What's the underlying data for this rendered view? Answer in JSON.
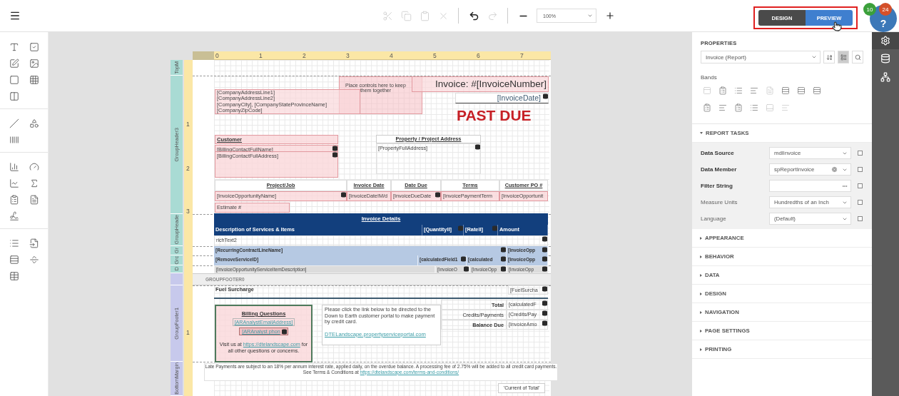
{
  "toolbar": {
    "actions": [
      {
        "kind": "cut",
        "disabled": true
      },
      {
        "kind": "copy",
        "disabled": true
      },
      {
        "kind": "paste",
        "disabled": true
      },
      {
        "kind": "delete",
        "disabled": true
      },
      {
        "kind": "undo",
        "disabled": false
      },
      {
        "kind": "redo",
        "disabled": true
      },
      {
        "kind": "zoom-out",
        "disabled": false
      }
    ],
    "zoom": "100%"
  },
  "mode_toggle": [
    {
      "label": "DESIGN",
      "selected": false
    },
    {
      "label": "PREVIEW",
      "selected": true
    }
  ],
  "help": {
    "label": "?"
  },
  "notifications": [
    {
      "count": "10",
      "color": "#3ba03b"
    },
    {
      "count": "24",
      "color": "#d4502a"
    }
  ],
  "report": {
    "ruler": [
      "0",
      "1",
      "2",
      "3",
      "4",
      "5",
      "6",
      "7"
    ],
    "vertical_ruler": [
      "1",
      "2",
      "3",
      "1"
    ],
    "bands": [
      {
        "name": "TopM",
        "kind": "header"
      },
      {
        "name": "GroupHeader3",
        "kind": "header"
      },
      {
        "name": "GroupHeade",
        "kind": "header"
      },
      {
        "name": "Gr",
        "kind": "header"
      },
      {
        "name": "Grc",
        "kind": "header"
      },
      {
        "name": "D",
        "kind": "header"
      },
      {
        "kind": "footer"
      },
      {
        "name": "GroupFooter1",
        "kind": "footer"
      },
      {
        "name": "BottomMargin",
        "kind": "footer"
      }
    ],
    "collapsed_band": "GROUPFOOTER0",
    "controls": [
      {
        "kind": "panel",
        "text": "Place controls here to keep them together"
      },
      {
        "kind": "address",
        "lines": [
          "[CompanyAddressLine1]",
          "[CompanyAddressLine2]",
          "[CompanyCity], [CompanyStateProvinceName]",
          "[CompanyZipCode]"
        ]
      },
      {
        "kind": "title",
        "text": "Invoice: #[InvoiceNumber]"
      },
      {
        "kind": "date",
        "text": "[InvoiceDate]",
        "bound": true
      },
      {
        "kind": "alert",
        "text": "PAST DUE"
      },
      {
        "kind": "caption",
        "text": "Customer"
      },
      {
        "kind": "field",
        "text": "[BillingContactFullName]",
        "bound": true
      },
      {
        "kind": "field",
        "text": "[BillingContactFullAddress]",
        "bound": true
      },
      {
        "kind": "heading",
        "text": "Property / Project Address"
      },
      {
        "kind": "plain",
        "text": "[PropertyFullAddress]",
        "bound": true
      },
      {
        "kind": "th",
        "text": "Project/Job"
      },
      {
        "kind": "th",
        "text": "Invoice Date"
      },
      {
        "kind": "th",
        "text": "Date Due"
      },
      {
        "kind": "th",
        "text": "Terms"
      },
      {
        "kind": "th",
        "text": "Customer PO #"
      },
      {
        "kind": "field",
        "text": "[InvoiceOpportunityName]",
        "bound": true
      },
      {
        "kind": "field",
        "text": "[InvoiceDate!M/d"
      },
      {
        "kind": "field",
        "text": "[InvoiceDueDate",
        "bound": true
      },
      {
        "kind": "field",
        "text": "[InvoicePaymentTerm"
      },
      {
        "kind": "field",
        "text": "[InvoiceOpportunit"
      },
      {
        "kind": "field",
        "text": "Estimate #"
      },
      {
        "kind": "navy-title",
        "text": "Invoice Details"
      },
      {
        "kind": "navy",
        "text": "Description of Services & Items"
      },
      {
        "kind": "navy",
        "text": "[QuantityII]",
        "bound": true
      },
      {
        "kind": "navy",
        "text": "[RateII]",
        "bound": true
      },
      {
        "kind": "navy",
        "text": "Amount"
      },
      {
        "kind": "plain",
        "text": "richText2",
        "bound": true
      },
      {
        "kind": "blue",
        "text": "[RecurringContractLineName]",
        "bound": true
      },
      {
        "kind": "blue",
        "text": "[InvoiceOpp",
        "bound": true
      },
      {
        "kind": "blue",
        "text": "[RemoveServiceID]"
      },
      {
        "kind": "blue",
        "text": "[calculatedField1",
        "bound": true
      },
      {
        "kind": "blue",
        "text": "[calculated",
        "bound": true
      },
      {
        "kind": "blue",
        "text": "[InvoiceOpp",
        "bound": true
      },
      {
        "kind": "gray",
        "text": "[InvoiceOpportunityServiceItemDescription]"
      },
      {
        "kind": "gray",
        "text": "[InvoiceO",
        "bound": true
      },
      {
        "kind": "gray",
        "text": "[InvoiceOpp",
        "bound": true
      },
      {
        "kind": "gray",
        "text": "[InvoiceOpp",
        "bound": true
      },
      {
        "kind": "bold",
        "text": "Fuel Surcharge"
      },
      {
        "kind": "plain",
        "text": "[FuelSurcha",
        "bound": true
      },
      {
        "kind": "billing",
        "title": "Billing Questions",
        "email": "[ARAnalystEmailAddress]",
        "phone": "[ARAnalyst phon",
        "visit_before": "Visit us at ",
        "link": "https://dtelandscape.com",
        "visit_after": " for all other questions or concerns."
      },
      {
        "kind": "note",
        "text": "Please click the link below to be directed to the Down to Earth customer portal to make payment by credit card.",
        "link": "DTELandscape.propertyserviceportal.com"
      },
      {
        "kind": "total",
        "text": "Total"
      },
      {
        "kind": "plain",
        "text": "[calculatedF",
        "bound": true
      },
      {
        "kind": "label",
        "text": "Credits/Payments"
      },
      {
        "kind": "plain",
        "text": "[Credits/Pay",
        "bound": true
      },
      {
        "kind": "total",
        "text": "Balance Due"
      },
      {
        "kind": "plain",
        "text": "[InvoiceAmo",
        "bound": true
      },
      {
        "kind": "legal",
        "text": "Late Payments are subject to an 18% per annum interest rate, applied daily, on the overdue balance. A processing fee of 2.75% will be added to all credit card payments.",
        "before": "See Terms & Conditions at ",
        "link": "https://dtelandscape.com/terms-and-conditions/"
      },
      {
        "kind": "box",
        "text": "'Current of Total'"
      }
    ]
  },
  "properties": {
    "title": "PROPERTIES",
    "selector": "Invoice (Report)",
    "tools": [
      {
        "kind": "sort",
        "selected": false
      },
      {
        "kind": "categories",
        "selected": true
      },
      {
        "kind": "search",
        "selected": false
      }
    ],
    "bands_label": "Bands",
    "tasks": {
      "title": "REPORT TASKS",
      "expanded": true,
      "rows": [
        {
          "label": "Data Source",
          "value": "mdlInvoice",
          "kind": "select",
          "emphasized": true,
          "checked": false
        },
        {
          "label": "Data Member",
          "value": "spReportInvoice",
          "kind": "clearable",
          "emphasized": true,
          "checked": false
        },
        {
          "label": "Filter String",
          "kind": "ellipsis",
          "emphasized": true,
          "checked": false
        },
        {
          "label": "Measure Units",
          "value": "Hundredths of an Inch",
          "kind": "select",
          "emphasized": false,
          "checked": false
        },
        {
          "label": "Language",
          "value": "(Default)",
          "kind": "select",
          "emphasized": false,
          "checked": false
        }
      ]
    },
    "sections": [
      {
        "title": "APPEARANCE",
        "expanded": false
      },
      {
        "title": "BEHAVIOR",
        "expanded": false
      },
      {
        "title": "DATA",
        "expanded": false
      },
      {
        "title": "DESIGN",
        "expanded": false
      },
      {
        "title": "NAVIGATION",
        "expanded": false
      },
      {
        "title": "PAGE SETTINGS",
        "expanded": false
      },
      {
        "title": "PRINTING",
        "expanded": false
      }
    ]
  },
  "sidebar": [
    {
      "kind": "settings",
      "selected": true
    },
    {
      "kind": "data",
      "selected": false
    },
    {
      "kind": "structure",
      "selected": false
    }
  ]
}
